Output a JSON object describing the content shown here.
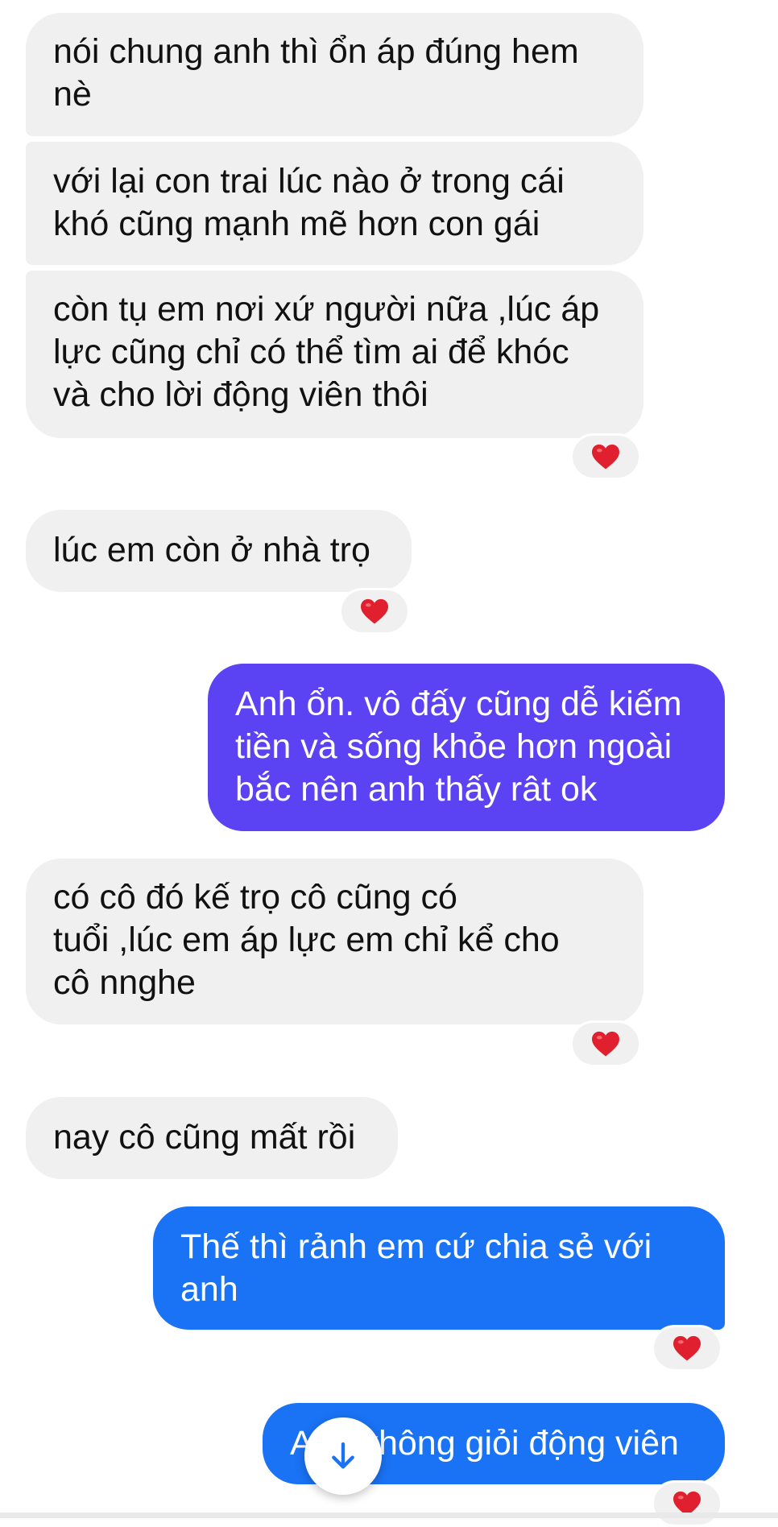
{
  "messages": [
    {
      "sender": "them",
      "text": "nói chung anh thì ổn áp đúng hem\nnè"
    },
    {
      "sender": "them",
      "text": "với lại con trai lúc nào ở trong cái\nkhó cũng mạnh mẽ hơn con gái"
    },
    {
      "sender": "them",
      "text": "còn tụ em nơi xứ người nữa ,lúc áp\nlực cũng chỉ có thể tìm ai để khóc\nvà cho lời động viên thôi",
      "reaction": "heart"
    },
    {
      "sender": "them",
      "text": "lúc em còn ở nhà trọ",
      "reaction": "heart"
    },
    {
      "sender": "me",
      "text": "Anh ổn. vô đấy cũng dễ kiếm\ntiền và sống khỏe hơn ngoài\nbắc nên anh thấy rât ok"
    },
    {
      "sender": "them",
      "text": "có cô đó kế trọ cô cũng có\ntuổi ,lúc em áp lực em chỉ kể cho\ncô nnghe",
      "reaction": "heart"
    },
    {
      "sender": "them",
      "text": "nay cô cũng mất rồi"
    },
    {
      "sender": "me",
      "text": "Thế thì rảnh em cứ chia sẻ với\nanh",
      "reaction": "heart"
    },
    {
      "sender": "me",
      "text": "Anh không giỏi động viên",
      "reaction": "heart"
    }
  ],
  "reaction_icon": "heart-icon",
  "scroll_button_icon": "arrow-down-icon",
  "colors": {
    "incoming_bubble": "#f0f0f0",
    "outgoing_gradient_top": "#5b42f3",
    "outgoing_gradient_bottom": "#1a73f5",
    "heart": "#e0202e"
  }
}
